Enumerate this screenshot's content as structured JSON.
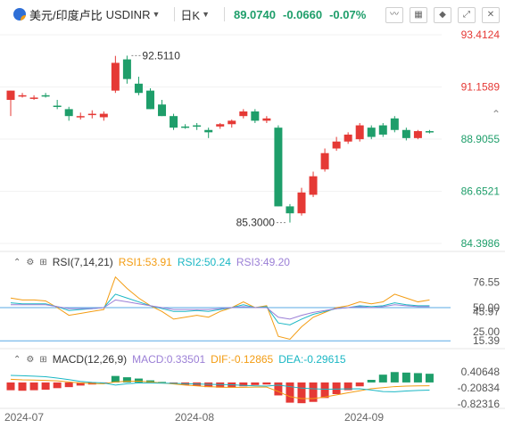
{
  "header": {
    "pair_name": "美元/印度卢比",
    "symbol": "USDINR",
    "caret": "▼",
    "timeframe": "日K",
    "last": "89.0740",
    "change": "-0.0660",
    "change_pct": "-0.07%",
    "tools": [
      "chart-draw-icon",
      "grid-icon",
      "shapes-icon",
      "expand-icon",
      "close-icon"
    ]
  },
  "rsi": {
    "title": "RSI(7,14,21)",
    "rsi1": "RSI1:53.91",
    "rsi2": "RSI2:50.24",
    "rsi3": "RSI3:49.20",
    "colors": {
      "rsi1": "#f39c12",
      "rsi2": "#1ab7c4",
      "rsi3": "#9b7fd6"
    }
  },
  "macd": {
    "title": "MACD(12,26,9)",
    "macd": "MACD:0.33501",
    "dif": "DIF:-0.12865",
    "dea": "DEA:-0.29615",
    "colors": {
      "macd": "#9b7fd6",
      "dif": "#f39c12",
      "dea": "#1ab7c4"
    }
  },
  "colors": {
    "up": "#e53935",
    "down": "#1e9e6a",
    "axis_text_up": "#e53935",
    "axis_text_down": "#1e9e6a"
  },
  "chart_data": [
    {
      "type": "candlestick",
      "y_ticks": [
        "93.4124",
        "91.1589",
        "88.9055",
        "86.6521",
        "84.3986"
      ],
      "y_tick_values": [
        93.4124,
        91.1589,
        88.9055,
        86.6521,
        84.3986
      ],
      "ylim": [
        84.3986,
        93.4124
      ],
      "x_ticks": [
        "2024-07",
        "2024-08",
        "2024-09"
      ],
      "annotations": [
        {
          "text": "92.5110",
          "value": 92.511
        },
        {
          "text": "85.3000",
          "value": 85.3
        }
      ],
      "candles": [
        {
          "o": 90.6,
          "h": 91.0,
          "l": 89.9,
          "c": 91.0
        },
        {
          "o": 90.8,
          "h": 90.9,
          "l": 90.7,
          "c": 90.8
        },
        {
          "o": 90.7,
          "h": 90.8,
          "l": 90.6,
          "c": 90.7
        },
        {
          "o": 90.8,
          "h": 90.9,
          "l": 90.7,
          "c": 90.75
        },
        {
          "o": 90.35,
          "h": 90.6,
          "l": 90.2,
          "c": 90.3
        },
        {
          "o": 90.2,
          "h": 90.3,
          "l": 89.7,
          "c": 89.9
        },
        {
          "o": 89.85,
          "h": 90.05,
          "l": 89.75,
          "c": 89.9
        },
        {
          "o": 89.95,
          "h": 90.15,
          "l": 89.8,
          "c": 90.0
        },
        {
          "o": 89.85,
          "h": 90.1,
          "l": 89.7,
          "c": 90.0
        },
        {
          "o": 91.0,
          "h": 92.5,
          "l": 90.9,
          "c": 92.2
        },
        {
          "o": 92.35,
          "h": 92.511,
          "l": 91.3,
          "c": 91.5
        },
        {
          "o": 91.3,
          "h": 91.6,
          "l": 90.8,
          "c": 90.9
        },
        {
          "o": 91.0,
          "h": 91.1,
          "l": 90.2,
          "c": 90.2
        },
        {
          "o": 90.4,
          "h": 90.6,
          "l": 89.9,
          "c": 89.9
        },
        {
          "o": 89.9,
          "h": 90.0,
          "l": 89.3,
          "c": 89.4
        },
        {
          "o": 89.45,
          "h": 89.55,
          "l": 89.35,
          "c": 89.4
        },
        {
          "o": 89.5,
          "h": 89.6,
          "l": 89.3,
          "c": 89.45
        },
        {
          "o": 89.3,
          "h": 89.4,
          "l": 88.95,
          "c": 89.2
        },
        {
          "o": 89.45,
          "h": 89.6,
          "l": 89.35,
          "c": 89.55
        },
        {
          "o": 89.55,
          "h": 89.75,
          "l": 89.4,
          "c": 89.7
        },
        {
          "o": 89.9,
          "h": 90.2,
          "l": 89.8,
          "c": 90.1
        },
        {
          "o": 90.1,
          "h": 90.2,
          "l": 89.6,
          "c": 89.7
        },
        {
          "o": 89.7,
          "h": 89.9,
          "l": 89.6,
          "c": 89.8
        },
        {
          "o": 89.4,
          "h": 89.5,
          "l": 86.0,
          "c": 86.0
        },
        {
          "o": 86.0,
          "h": 86.1,
          "l": 85.3,
          "c": 85.7
        },
        {
          "o": 85.7,
          "h": 86.8,
          "l": 85.6,
          "c": 86.6
        },
        {
          "o": 86.5,
          "h": 87.5,
          "l": 86.4,
          "c": 87.3
        },
        {
          "o": 87.6,
          "h": 88.5,
          "l": 87.5,
          "c": 88.3
        },
        {
          "o": 88.5,
          "h": 89.0,
          "l": 88.4,
          "c": 88.8
        },
        {
          "o": 88.8,
          "h": 89.2,
          "l": 88.7,
          "c": 89.1
        },
        {
          "o": 88.9,
          "h": 89.6,
          "l": 88.8,
          "c": 89.5
        },
        {
          "o": 89.4,
          "h": 89.5,
          "l": 88.9,
          "c": 89.0
        },
        {
          "o": 89.5,
          "h": 89.6,
          "l": 89.0,
          "c": 89.1
        },
        {
          "o": 89.8,
          "h": 89.9,
          "l": 89.2,
          "c": 89.3
        },
        {
          "o": 89.3,
          "h": 89.4,
          "l": 88.85,
          "c": 88.95
        },
        {
          "o": 88.95,
          "h": 89.3,
          "l": 88.9,
          "c": 89.25
        },
        {
          "o": 89.25,
          "h": 89.3,
          "l": 89.15,
          "c": 89.2
        }
      ]
    },
    {
      "type": "line",
      "name": "RSI",
      "y_ticks": [
        "76.55",
        "50.00",
        "45.97",
        "25.00",
        "15.39"
      ],
      "y_tick_values": [
        76.55,
        50.0,
        45.97,
        25.0,
        15.39
      ],
      "ylim": [
        10,
        90
      ],
      "ref_lines": [
        50,
        15.39
      ],
      "series": [
        {
          "name": "RSI1",
          "values": [
            60,
            58,
            58,
            57,
            50,
            42,
            44,
            46,
            48,
            82,
            70,
            60,
            52,
            46,
            38,
            40,
            42,
            40,
            46,
            50,
            56,
            50,
            52,
            20,
            17,
            30,
            40,
            45,
            50,
            52,
            56,
            54,
            56,
            64,
            60,
            56,
            58
          ]
        },
        {
          "name": "RSI2",
          "values": [
            55,
            54,
            54,
            54,
            51,
            47,
            48,
            49,
            50,
            64,
            60,
            56,
            52,
            49,
            46,
            46,
            47,
            46,
            48,
            50,
            53,
            50,
            51,
            34,
            32,
            38,
            43,
            46,
            49,
            50,
            52,
            51,
            52,
            55,
            53,
            52,
            52
          ]
        },
        {
          "name": "RSI3",
          "values": [
            53,
            53,
            53,
            53,
            51,
            49,
            49,
            49,
            50,
            58,
            56,
            54,
            52,
            50,
            48,
            48,
            48,
            48,
            49,
            50,
            51,
            50,
            50,
            40,
            38,
            42,
            45,
            47,
            49,
            50,
            51,
            50,
            51,
            53,
            52,
            51,
            51
          ]
        }
      ]
    },
    {
      "type": "bar+line",
      "name": "MACD",
      "y_ticks": [
        "0.40648",
        "-0.20834",
        "-0.82316"
      ],
      "y_tick_values": [
        0.40648,
        -0.20834,
        -0.82316
      ],
      "ylim": [
        -1.0,
        0.65
      ],
      "histogram": [
        -0.3,
        -0.32,
        -0.3,
        -0.28,
        -0.22,
        -0.18,
        -0.12,
        -0.08,
        -0.05,
        0.25,
        0.2,
        0.15,
        0.08,
        0.02,
        -0.05,
        -0.1,
        -0.14,
        -0.18,
        -0.2,
        -0.2,
        -0.15,
        -0.1,
        -0.08,
        -0.5,
        -0.78,
        -0.8,
        -0.75,
        -0.6,
        -0.45,
        -0.3,
        -0.15,
        0.1,
        0.3,
        0.4,
        0.38,
        0.36,
        0.33501
      ],
      "series": [
        {
          "name": "DIF",
          "values": [
            0.12,
            0.1,
            0.09,
            0.08,
            0.06,
            0.02,
            -0.02,
            -0.04,
            -0.05,
            0.02,
            0.05,
            0.05,
            0.02,
            -0.02,
            -0.06,
            -0.1,
            -0.13,
            -0.16,
            -0.18,
            -0.19,
            -0.19,
            -0.18,
            -0.18,
            -0.35,
            -0.55,
            -0.62,
            -0.62,
            -0.56,
            -0.48,
            -0.4,
            -0.32,
            -0.24,
            -0.2,
            -0.16,
            -0.14,
            -0.13,
            -0.12865
          ]
        },
        {
          "name": "DEA",
          "values": [
            0.27,
            0.26,
            0.24,
            0.22,
            0.17,
            0.11,
            0.04,
            0.0,
            -0.02,
            -0.1,
            -0.05,
            -0.02,
            -0.02,
            -0.03,
            -0.035,
            -0.05,
            -0.06,
            -0.07,
            -0.08,
            -0.09,
            -0.115,
            -0.13,
            -0.14,
            -0.1,
            -0.16,
            -0.22,
            -0.245,
            -0.26,
            -0.255,
            -0.25,
            -0.245,
            -0.29,
            -0.35,
            -0.36,
            -0.33,
            -0.31,
            -0.29615
          ]
        }
      ]
    }
  ]
}
